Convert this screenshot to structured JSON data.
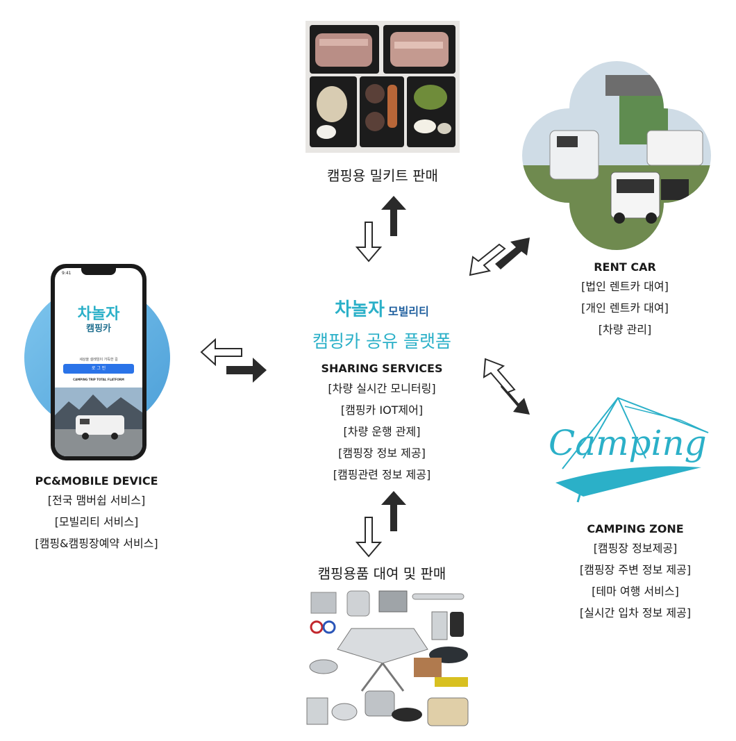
{
  "top": {
    "title": "캠핑용 밀키트 판매"
  },
  "bottom": {
    "title": "캠핑용품 대여 및 판매"
  },
  "left": {
    "heading": "PC&MOBILE DEVICE",
    "items": [
      "[전국 맴버쉽 서비스]",
      "[모빌리티 서비스]",
      "[캠핑&캠핑장예약 서비스]"
    ]
  },
  "phone": {
    "time": "9:41",
    "logo": "차놀자",
    "logo_sub": "캠핑카",
    "tagline": "세상을 설레임이 가득한 길",
    "login_button": "로 그 인",
    "footer": "CAMPING TRIP TOTAL FLATFORM"
  },
  "center": {
    "logo": "차놀자",
    "logo_suffix": "모빌리티",
    "title": "캠핑카 공유 플랫폼",
    "heading": "SHARING SERVICES",
    "items": [
      "[차량 실시간 모니터링]",
      "[캠핑카 IOT제어]",
      "[차량 운행 관제]",
      "[캠핑장 정보 제공]",
      "[캠핑관련 정보 제공]"
    ]
  },
  "right_top": {
    "heading": "RENT CAR",
    "items": [
      "[법인 렌트카 대여]",
      "[개인 렌트카 대여]",
      "[차량 관리]"
    ]
  },
  "right_bottom": {
    "logo_text": "Camping",
    "heading": "CAMPING ZONE",
    "items": [
      "[캠핑장 정보제공]",
      "[캠핑장 주변 정보 제공]",
      "[테마 여행 서비스]",
      "[실시간 입차 정보 제공]"
    ]
  },
  "colors": {
    "accent": "#2bb0c8",
    "arrow": "#2a2a2a"
  }
}
